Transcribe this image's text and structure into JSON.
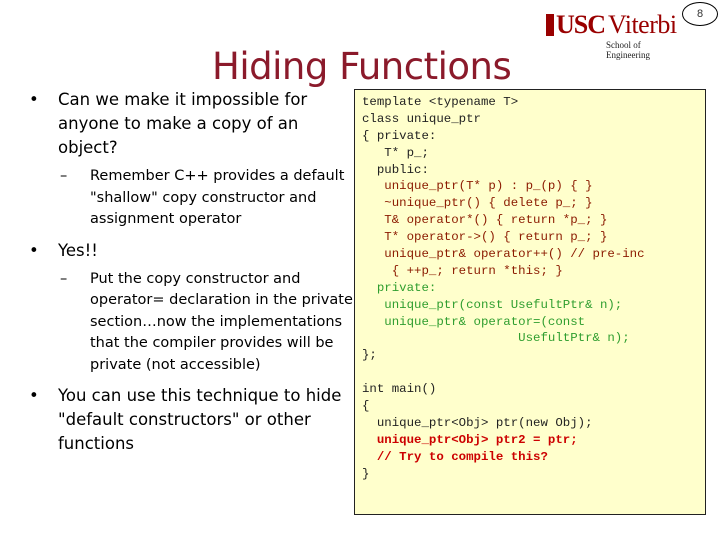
{
  "header": {
    "logo_usc": "USC",
    "logo_viterbi": "Viterbi",
    "logo_subtitle": "School of Engineering",
    "page_number": "8"
  },
  "slide": {
    "title": "Hiding Functions",
    "bullets": [
      {
        "level": 1,
        "mark": "•",
        "text": "Can we make it impossible for anyone to make a copy of an object?"
      },
      {
        "level": 2,
        "mark": "–",
        "text": "Remember C++ provides a default \"shallow\" copy constructor and assignment operator"
      },
      {
        "level": 1,
        "mark": "•",
        "text": "Yes!!"
      },
      {
        "level": 2,
        "mark": "–",
        "text": "Put the copy constructor and operator= declaration in the private section…now the implementations that the compiler provides will be private (not accessible)"
      },
      {
        "level": 1,
        "mark": "•",
        "text": "You can use this technique to hide \"default constructors\" or other functions"
      }
    ]
  },
  "code": {
    "lines": [
      {
        "text": "template <typename T>",
        "color": "black"
      },
      {
        "text": "class unique_ptr",
        "color": "black"
      },
      {
        "text": "{ private:",
        "color": "black"
      },
      {
        "text": "   T* p_;",
        "color": "black"
      },
      {
        "text": "  public:",
        "color": "black"
      },
      {
        "text": "   unique_ptr(T* p) : p_(p) { }",
        "color": "brown"
      },
      {
        "text": "   ~unique_ptr() { delete p_; }",
        "color": "brown"
      },
      {
        "text": "   T& operator*() { return *p_; }",
        "color": "brown"
      },
      {
        "text": "   T* operator->() { return p_; }",
        "color": "brown"
      },
      {
        "text": "   unique_ptr& operator++() // pre-inc",
        "color": "brown"
      },
      {
        "text": "    { ++p_; return *this; }",
        "color": "brown"
      },
      {
        "text": "  private:",
        "color": "green"
      },
      {
        "text": "   unique_ptr(const UsefultPtr& n);",
        "color": "green"
      },
      {
        "text": "   unique_ptr& operator=(const",
        "color": "green"
      },
      {
        "text": "                     UsefultPtr& n);",
        "color": "green"
      },
      {
        "text": "};",
        "color": "black"
      },
      {
        "text": "",
        "color": "black"
      },
      {
        "text": "int main()",
        "color": "black"
      },
      {
        "text": "{",
        "color": "black"
      },
      {
        "text": "  unique_ptr<Obj> ptr(new Obj);",
        "color": "black"
      },
      {
        "text": "  unique_ptr<Obj> ptr2 = ptr;",
        "color": "red"
      },
      {
        "text": "  // Try to compile this?",
        "color": "red"
      },
      {
        "text": "}",
        "color": "black"
      }
    ]
  },
  "colors": {
    "brand": "#990000",
    "title": "#8b1a2b",
    "code_bg": "#ffffcc",
    "code_brown": "#8b1a00",
    "code_green": "#2f9e2f",
    "code_red": "#cc0000"
  }
}
